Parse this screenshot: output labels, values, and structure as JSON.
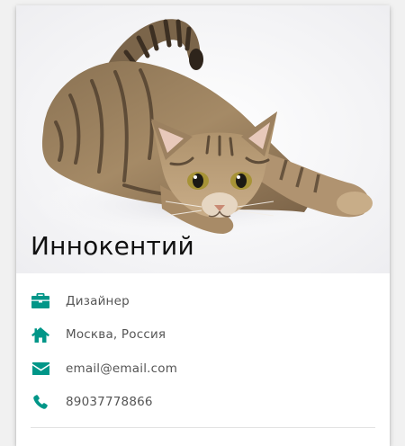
{
  "profile": {
    "name": "Иннокентий",
    "photo_subject": "tabby-cat-photo"
  },
  "details": [
    {
      "icon": "briefcase-icon",
      "text": "Дизайнер"
    },
    {
      "icon": "home-icon",
      "text": "Москва, Россия"
    },
    {
      "icon": "envelope-icon",
      "text": "email@email.com"
    },
    {
      "icon": "phone-icon",
      "text": "89037778866"
    }
  ],
  "colors": {
    "accent": "#009688",
    "text": "#555555",
    "name": "#111111"
  }
}
